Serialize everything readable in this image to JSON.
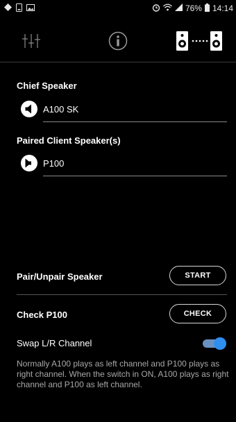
{
  "status_bar": {
    "battery_percent": "76%",
    "time": "14:14"
  },
  "toolbar": {
    "equalizer_icon": "sliders-icon",
    "info_icon": "info-icon",
    "pairing_icon": "speaker-pair-icon"
  },
  "chief": {
    "label": "Chief Speaker",
    "speaker_name": "A100 SK"
  },
  "paired": {
    "label": "Paired Client Speaker(s)",
    "speaker_name": "P100"
  },
  "pair_row": {
    "label": "Pair/Unpair Speaker",
    "button": "START"
  },
  "check_row": {
    "label": "Check P100",
    "button": "CHECK"
  },
  "swap": {
    "label": "Swap L/R Channel",
    "enabled": true,
    "description": "Normally A100 plays as left channel and P100 plays as right channel. When the switch in ON, A100 plays as right channel and P100 as left channel."
  },
  "colors": {
    "background": "#000000",
    "toggle_on": "#2f8fef",
    "muted_text": "#a8a8a8"
  }
}
